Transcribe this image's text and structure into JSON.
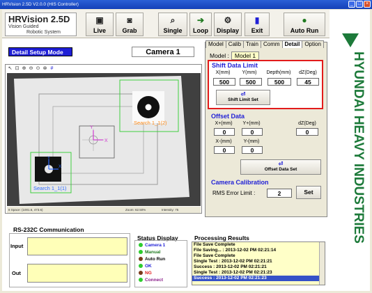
{
  "window": {
    "title": "HRVision 2.5D V2.0.0 (HIS Controller)"
  },
  "brand": {
    "name": "HRVision 2.5D",
    "line1": "Vision Guided",
    "line2": "Robotic System"
  },
  "toolbar": {
    "live": "Live",
    "grab": "Grab",
    "single": "Single",
    "loop": "Loop",
    "display": "Display",
    "exit": "Exit",
    "auto_run": "Auto Run"
  },
  "logo": {
    "text": "HYUNDAI HEAVY INDUSTRIES",
    "color": "#1d7a3a"
  },
  "setup": {
    "mode_label": "Detail Setup Mode",
    "camera": "Camera 1"
  },
  "viewer": {
    "search1": "Search 1_1(1)",
    "search2": "Search 1_1(2)",
    "axis_x": "X",
    "axis_y": "Y",
    "status_space": "8 Space: (1001.6, 473.6)",
    "status_zoom": "Zoom: 62.50%",
    "status_intensity": "Intensity: 75"
  },
  "tabs": [
    "Model",
    "Calib",
    "Train",
    "Comm",
    "Detail",
    "Option"
  ],
  "model": {
    "label": "Model :",
    "value": "Model 1"
  },
  "shift_limit": {
    "title": "Shift Data Limit",
    "headers": [
      "X(mm)",
      "Y(mm)",
      "Depth(mm)",
      "dZ(Deg)"
    ],
    "values": [
      "500",
      "500",
      "500",
      "45"
    ],
    "button": "Shift Limit Set"
  },
  "offset": {
    "title": "Offset Data",
    "row1_labels": [
      "X+(mm)",
      "Y+(mm)",
      "dZ(Deg)"
    ],
    "row1_values": [
      "0",
      "0",
      "0"
    ],
    "row2_labels": [
      "X-(mm)",
      "Y-(mm)"
    ],
    "row2_values": [
      "0",
      "0"
    ],
    "button": "Offset Data Set"
  },
  "calibration": {
    "title": "Camera Calibration",
    "label": "RMS Error Limit :",
    "value": "2",
    "button": "Set"
  },
  "rs232": {
    "title": "RS-232C Communication",
    "input_label": "Input",
    "output_label": "Out"
  },
  "status": {
    "title": "Status Display",
    "items": [
      {
        "label": "Camera 1",
        "color": "#1f1fd6"
      },
      {
        "label": "Manual",
        "color": "#1f7a1f"
      },
      {
        "label": "Auto Run",
        "color": "#000000"
      },
      {
        "label": "OK",
        "color": "#1f1fd6"
      },
      {
        "label": "NG",
        "color": "#e21b1b"
      },
      {
        "label": "Connect",
        "color": "#8a1f8a"
      }
    ]
  },
  "processing": {
    "title": "Processing Results",
    "lines": [
      "File Save Complete",
      "File Saving... : 2013-12-02 PM 02:21:14",
      "File Save Complete",
      "Single Test : 2013-12-02 PM 02:21:21",
      "Success : 2013-12-02 PM 02:21:21",
      "Single Test : 2013-12-02 PM 02:21:23",
      "Success : 2013-12-02 PM 02:21:23"
    ]
  }
}
